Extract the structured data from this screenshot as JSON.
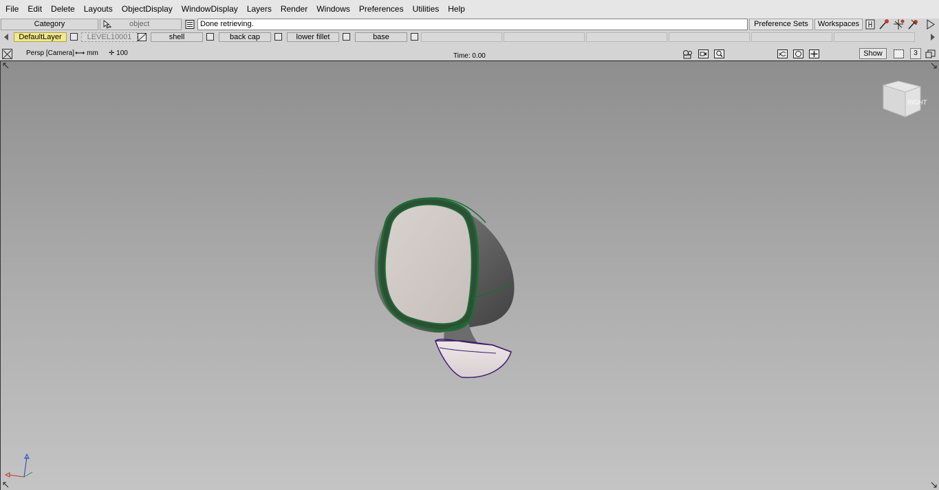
{
  "menu": [
    "File",
    "Edit",
    "Delete",
    "Layouts",
    "ObjectDisplay",
    "WindowDisplay",
    "Layers",
    "Render",
    "Windows",
    "Preferences",
    "Utilities",
    "Help"
  ],
  "toolbar": {
    "category": "Category",
    "object": "object",
    "status": "Done retrieving.",
    "preference_sets": "Preference Sets",
    "workspaces": "Workspaces"
  },
  "layers": {
    "default": "DefaultLayer",
    "level": "LEVEL10001",
    "items": [
      "shell",
      "back cap",
      "lower fillet",
      "base"
    ]
  },
  "viewport": {
    "label": "Persp [Camera]",
    "units": "mm",
    "grid": "100",
    "time": "Time: 0.00",
    "show": "Show",
    "number": "3",
    "viewcube_face": "RIGHT"
  },
  "colors": {
    "accent_layer": "#f3e98c",
    "curve_green": "#1f6b33",
    "curve_purple": "#3b1d6b"
  }
}
